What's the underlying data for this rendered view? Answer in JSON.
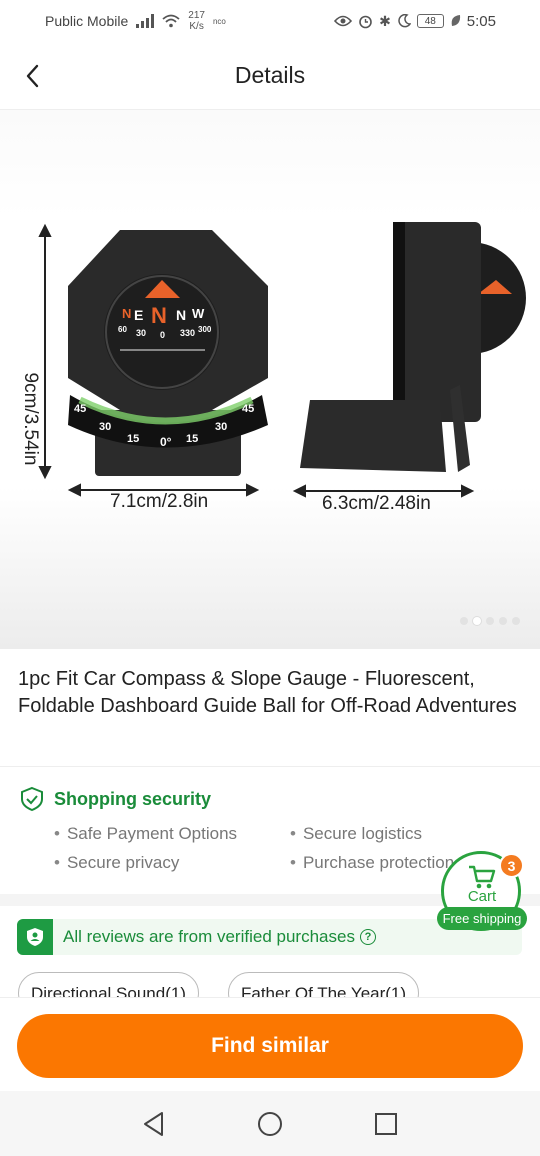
{
  "status_bar": {
    "carrier": "Public Mobile",
    "net_speed_value": "217",
    "net_speed_unit": "K/s",
    "nfc": "nco",
    "battery": "48",
    "time": "5:05"
  },
  "header": {
    "title": "Details"
  },
  "product_image": {
    "height_label": "9cm/3.54in",
    "front_width_label": "7.1cm/2.8in",
    "side_width_label": "6.3cm/2.48in",
    "compass_letters": [
      "N",
      "E",
      "N",
      "N",
      "W"
    ],
    "compass_numbers": [
      "60",
      "30",
      "0",
      "330",
      "300"
    ],
    "slope_marks": [
      "45",
      "30",
      "15",
      "0°",
      "15",
      "30",
      "45"
    ],
    "carousel_total": 5,
    "carousel_active_index": 1
  },
  "product": {
    "title": "1pc Fit Car Compass & Slope Gauge - Fluorescent, Foldable Dashboard Guide Ball for Off-Road Adventures"
  },
  "security": {
    "title": "Shopping security",
    "items": [
      "Safe Payment Options",
      "Secure logistics",
      "Secure privacy",
      "Purchase protection"
    ]
  },
  "reviews": {
    "verified_text": "All reviews are from verified purchases",
    "help_glyph": "?",
    "tags": [
      "Directional Sound(1)",
      "Father Of The Year(1)"
    ]
  },
  "cart": {
    "label": "Cart",
    "count": "3",
    "free_shipping": "Free shipping"
  },
  "actions": {
    "find_similar": "Find similar"
  },
  "colors": {
    "brand_orange": "#fb7701",
    "security_green": "#1a8c3a",
    "cart_green": "#2aa33f"
  }
}
